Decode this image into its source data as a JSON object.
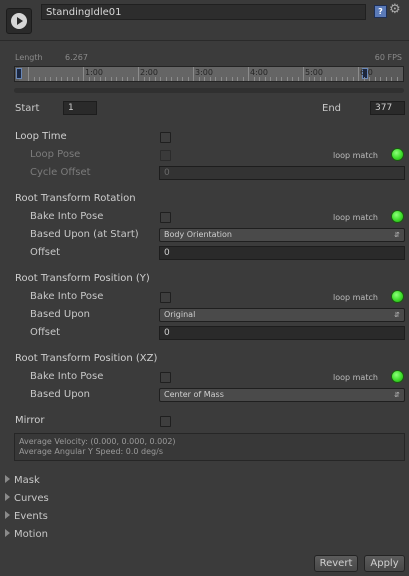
{
  "clip": {
    "name": "StandingIdle01",
    "help_icon": "?",
    "gear_icon": "⚙"
  },
  "timeline": {
    "length_label": "Length",
    "length_value": "6.267",
    "fps": "60 FPS",
    "ticks": [
      "1:00",
      "2:00",
      "3:00",
      "4:00",
      "5:00",
      "6:0"
    ],
    "scroll_position_percent": 0
  },
  "range": {
    "start_label": "Start",
    "start_value": "1",
    "end_label": "End",
    "end_value": "377"
  },
  "loop": {
    "loop_time_label": "Loop Time",
    "loop_pose_label": "Loop Pose",
    "cycle_offset_label": "Cycle Offset",
    "cycle_offset_value": "0",
    "loop_match_label": "loop match"
  },
  "rotation": {
    "title": "Root Transform Rotation",
    "bake_label": "Bake Into Pose",
    "based_label": "Based Upon (at Start)",
    "based_value": "Body Orientation",
    "offset_label": "Offset",
    "offset_value": "0",
    "loop_match_label": "loop match"
  },
  "position_y": {
    "title": "Root Transform Position (Y)",
    "bake_label": "Bake Into Pose",
    "based_label": "Based Upon",
    "based_value": "Original",
    "offset_label": "Offset",
    "offset_value": "0",
    "loop_match_label": "loop match"
  },
  "position_xz": {
    "title": "Root Transform Position (XZ)",
    "bake_label": "Bake Into Pose",
    "based_label": "Based Upon",
    "based_value": "Center of Mass",
    "loop_match_label": "loop match"
  },
  "mirror": {
    "label": "Mirror"
  },
  "info": {
    "avg_velocity": "Average Velocity: (0.000, 0.000, 0.002)",
    "avg_angular": "Average Angular Y Speed: 0.0 deg/s"
  },
  "foldouts": {
    "mask": "Mask",
    "curves": "Curves",
    "events": "Events",
    "motion": "Motion"
  },
  "buttons": {
    "revert": "Revert",
    "apply": "Apply"
  },
  "colors": {
    "background": "#3b3b3b",
    "loop_match_indicator": "#3ddc2a",
    "marker": "#1a2742"
  }
}
